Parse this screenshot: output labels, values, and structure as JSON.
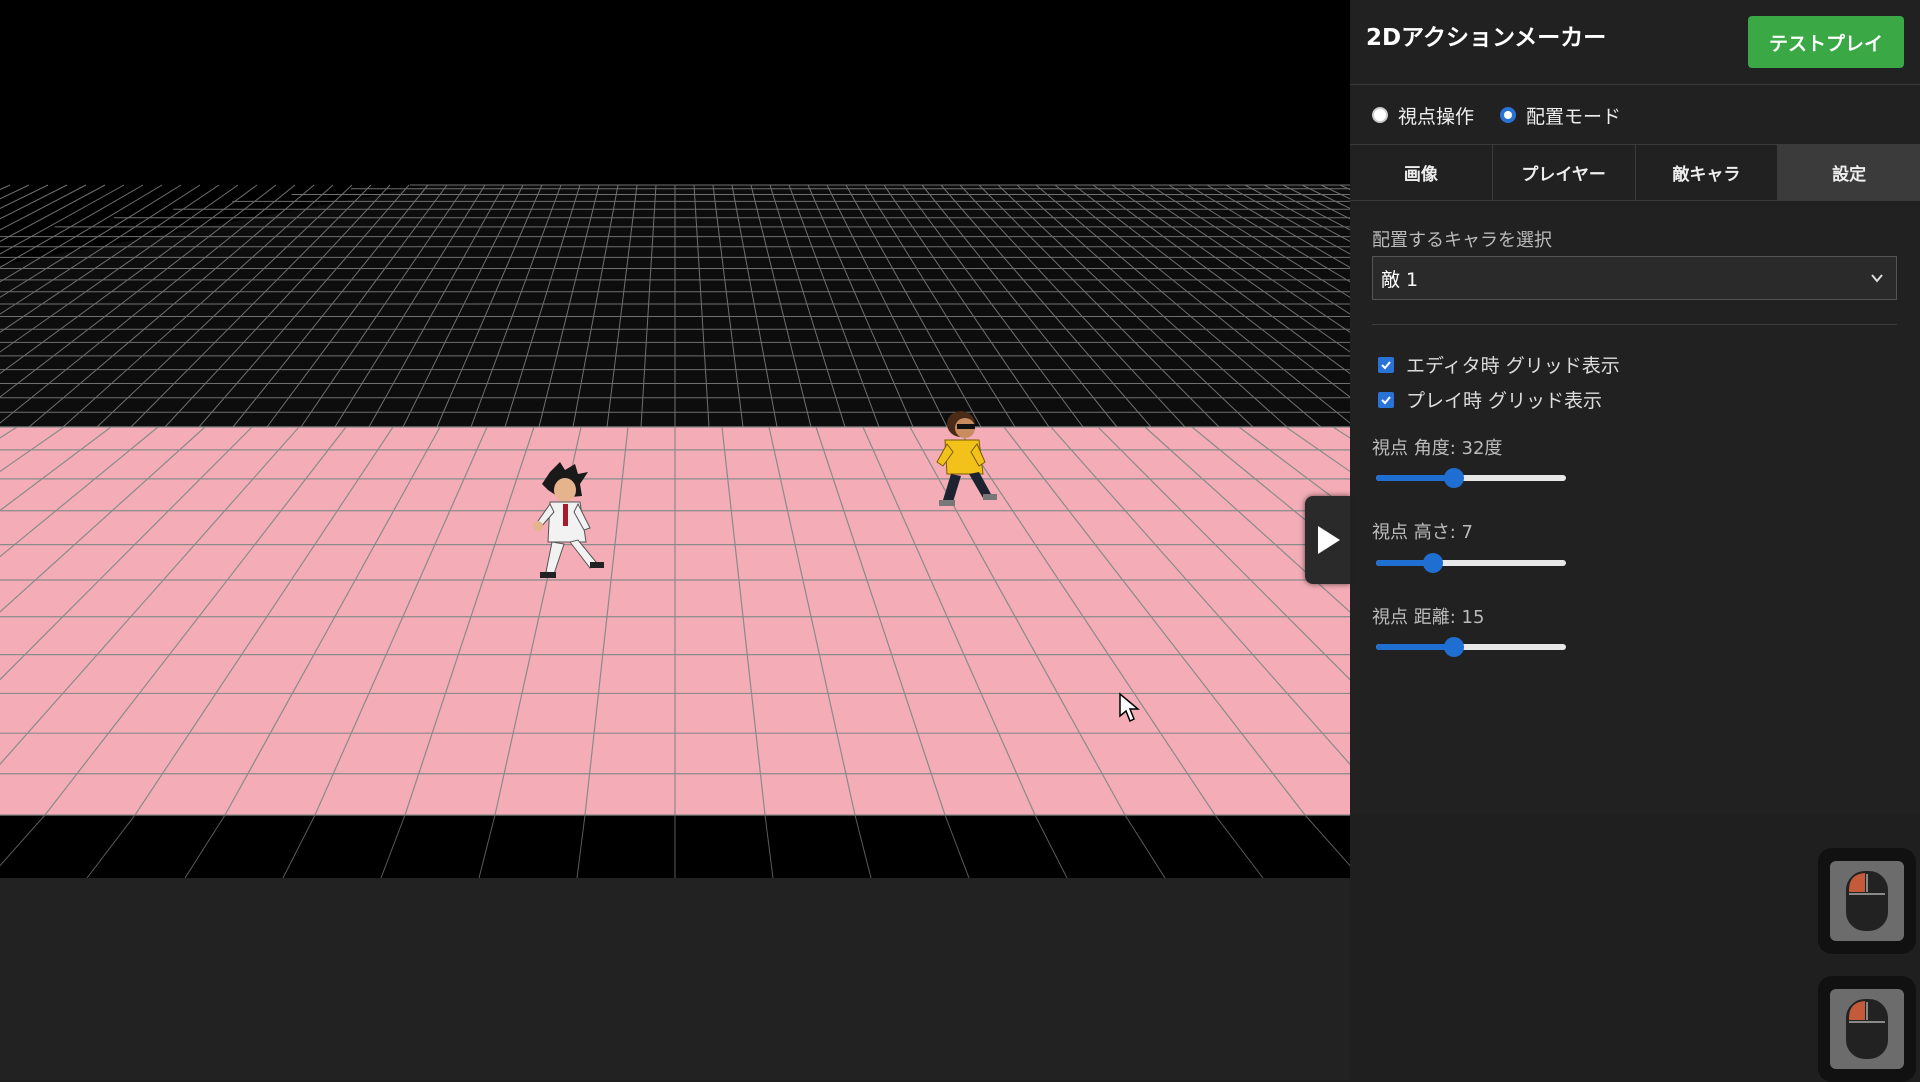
{
  "app": {
    "title": "2Dアクションメーカー",
    "testplay_label": "テストプレイ",
    "accent_color": "#3aa845"
  },
  "mode": {
    "options": [
      "視点操作",
      "配置モード"
    ],
    "selected": "配置モード"
  },
  "tabs": [
    {
      "label": "画像",
      "active": false
    },
    {
      "label": "プレイヤー",
      "active": false
    },
    {
      "label": "敵キャラ",
      "active": false
    },
    {
      "label": "設定",
      "active": true
    }
  ],
  "placement": {
    "label": "配置するキャラを選択",
    "selected": "敵 1"
  },
  "checkboxes": [
    {
      "label": "エディタ時 グリッド表示",
      "checked": true
    },
    {
      "label": "プレイ時 グリッド表示",
      "checked": true
    }
  ],
  "sliders": [
    {
      "label": "視点 角度: 32度",
      "fraction": 0.41
    },
    {
      "label": "視点 高さ: 7",
      "fraction": 0.3
    },
    {
      "label": "視点 距離: 15",
      "fraction": 0.41
    }
  ],
  "scene": {
    "floor_color": "#f4adb6",
    "sky_color": "#000000",
    "grid_color": "#8a8a8a",
    "icons": {
      "play": "play-icon",
      "mouse_left": "mouse-left-click-icon",
      "mouse_right": "mouse-right-click-icon"
    }
  }
}
